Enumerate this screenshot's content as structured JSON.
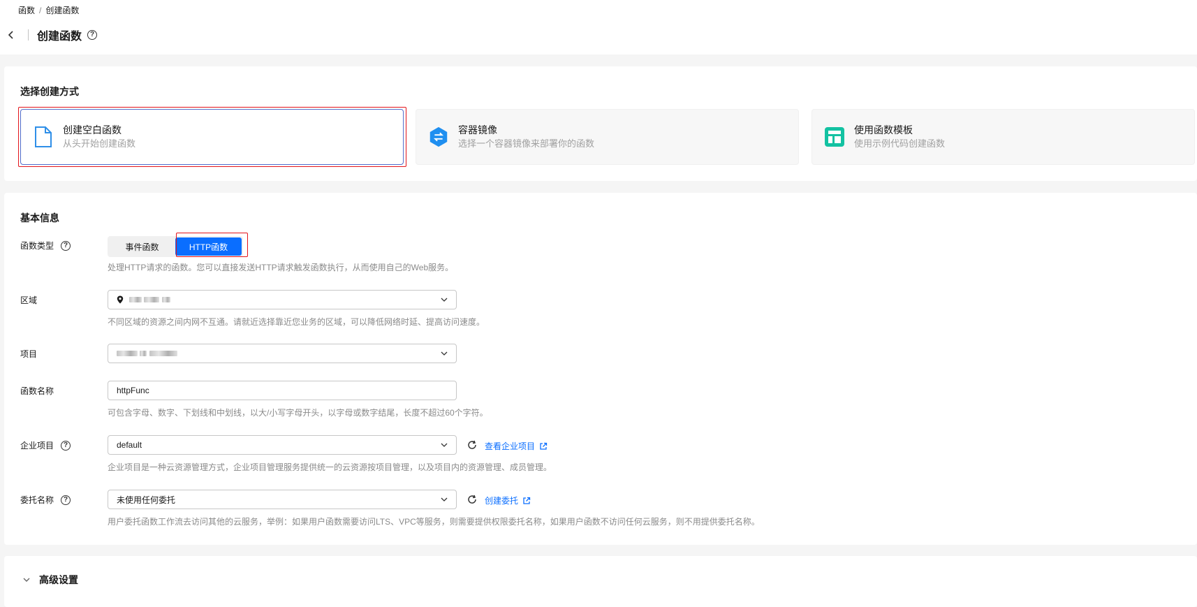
{
  "breadcrumb": {
    "parent": "函数",
    "separator": "/",
    "current": "创建函数"
  },
  "header": {
    "title": "创建函数"
  },
  "create_method": {
    "section_title": "选择创建方式",
    "options": [
      {
        "title": "创建空白函数",
        "subtitle": "从头开始创建函数",
        "icon": "blank-file-icon",
        "selected": true
      },
      {
        "title": "容器镜像",
        "subtitle": "选择一个容器镜像来部署你的函数",
        "icon": "container-image-icon",
        "selected": false
      },
      {
        "title": "使用函数模板",
        "subtitle": "使用示例代码创建函数",
        "icon": "template-icon",
        "selected": false
      }
    ]
  },
  "basic_info": {
    "section_title": "基本信息",
    "function_type": {
      "label": "函数类型",
      "options": [
        "事件函数",
        "HTTP函数"
      ],
      "selected": "HTTP函数",
      "hint": "处理HTTP请求的函数。您可以直接发送HTTP请求触发函数执行，从而使用自己的Web服务。"
    },
    "region": {
      "label": "区域",
      "hint": "不同区域的资源之间内网不互通。请就近选择靠近您业务的区域，可以降低网络时延、提高访问速度。"
    },
    "project": {
      "label": "项目"
    },
    "function_name": {
      "label": "函数名称",
      "value": "httpFunc",
      "hint": "可包含字母、数字、下划线和中划线，以大/小写字母开头，以字母或数字结尾，长度不超过60个字符。"
    },
    "enterprise_project": {
      "label": "企业项目",
      "value": "default",
      "link": "查看企业项目",
      "hint": "企业项目是一种云资源管理方式，企业项目管理服务提供统一的云资源按项目管理，以及项目内的资源管理、成员管理。"
    },
    "agency": {
      "label": "委托名称",
      "value": "未使用任何委托",
      "link": "创建委托",
      "hint": "用户委托函数工作流去访问其他的云服务，举例：如果用户函数需要访问LTS、VPC等服务，则需要提供权限委托名称，如果用户函数不访问任何云服务，则不用提供委托名称。"
    }
  },
  "advanced": {
    "label": "高级设置"
  },
  "colors": {
    "primary": "#0a6eff",
    "highlight": "#e3141b",
    "selected_border": "#526ecc"
  }
}
